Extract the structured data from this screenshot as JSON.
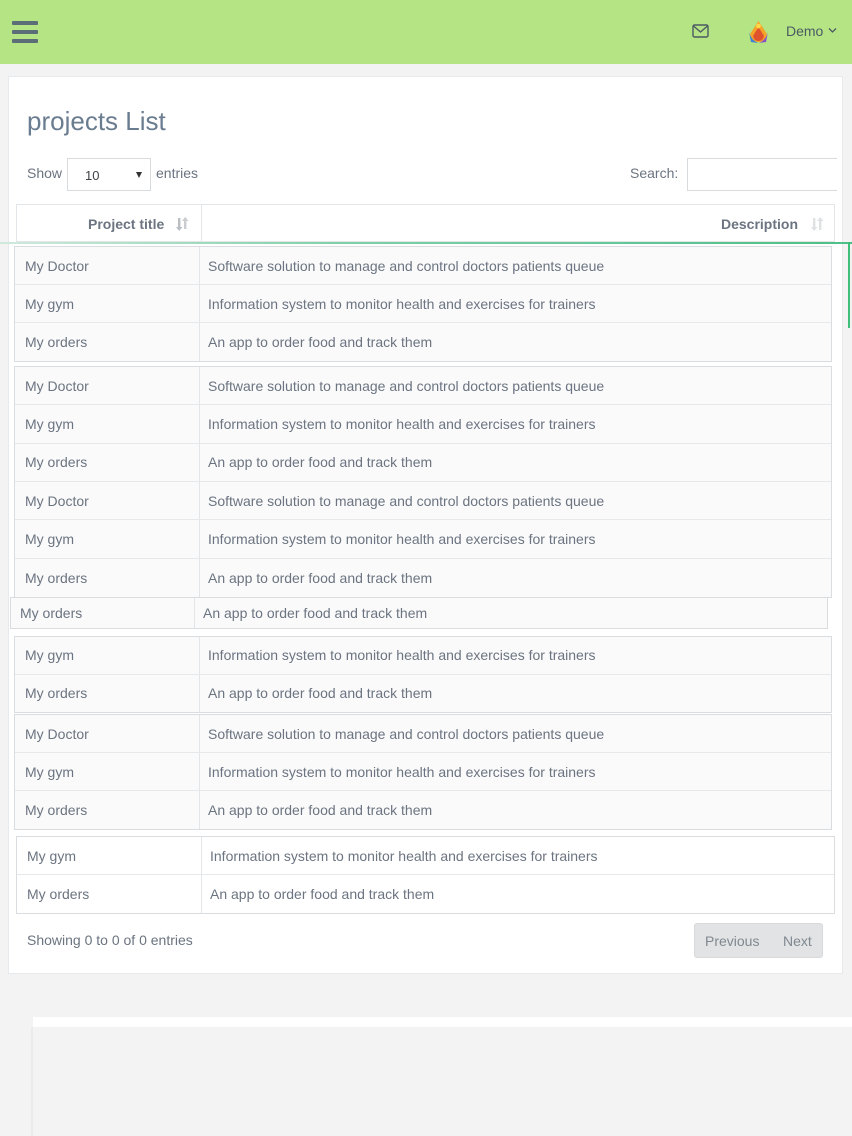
{
  "header": {
    "menu_icon": "hamburger-icon",
    "mail_icon": "envelope-icon",
    "user_name": "Demo",
    "user_chevron_icon": "chevron-down-icon"
  },
  "page": {
    "title": "projects List"
  },
  "controls": {
    "show_label": "Show",
    "entries_value": "10",
    "entries_label": "entries",
    "search_label": "Search:",
    "search_value": ""
  },
  "table": {
    "columns": [
      "Project title",
      "Description"
    ],
    "blocks": [
      {
        "rows": [
          [
            "My Doctor",
            "Software solution to manage and control doctors patients queue"
          ],
          [
            "My gym",
            "Information system to monitor health and exercises for trainers"
          ],
          [
            "My orders",
            "An app to order food and track them"
          ]
        ]
      },
      {
        "rows": [
          [
            "My Doctor",
            "Software solution to manage and control doctors patients queue"
          ],
          [
            "My gym",
            "Information system to monitor health and exercises for trainers"
          ],
          [
            "My orders",
            "An app to order food and track them"
          ],
          [
            "My Doctor",
            "Software solution to manage and control doctors patients queue"
          ],
          [
            "My gym",
            "Information system to monitor health and exercises for trainers"
          ],
          [
            "My orders",
            "An app to order food and track them"
          ]
        ]
      },
      {
        "rows": [
          [
            "My orders",
            "An app to order food and track them"
          ]
        ]
      },
      {
        "rows": [
          [
            "My gym",
            "Information system to monitor health and exercises for trainers"
          ],
          [
            "My orders",
            "An app to order food and track them"
          ]
        ]
      },
      {
        "rows": [
          [
            "My Doctor",
            "Software solution to manage and control doctors patients queue"
          ],
          [
            "My gym",
            "Information system to monitor health and exercises for trainers"
          ],
          [
            "My orders",
            "An app to order food and track them"
          ]
        ]
      },
      {
        "rows": [
          [
            "My gym",
            "Information system to monitor health and exercises for trainers"
          ],
          [
            "My orders",
            "An app to order food and track them"
          ]
        ]
      }
    ]
  },
  "footer": {
    "info": "Showing 0 to 0 of 0 entries",
    "previous": "Previous",
    "next": "Next"
  }
}
